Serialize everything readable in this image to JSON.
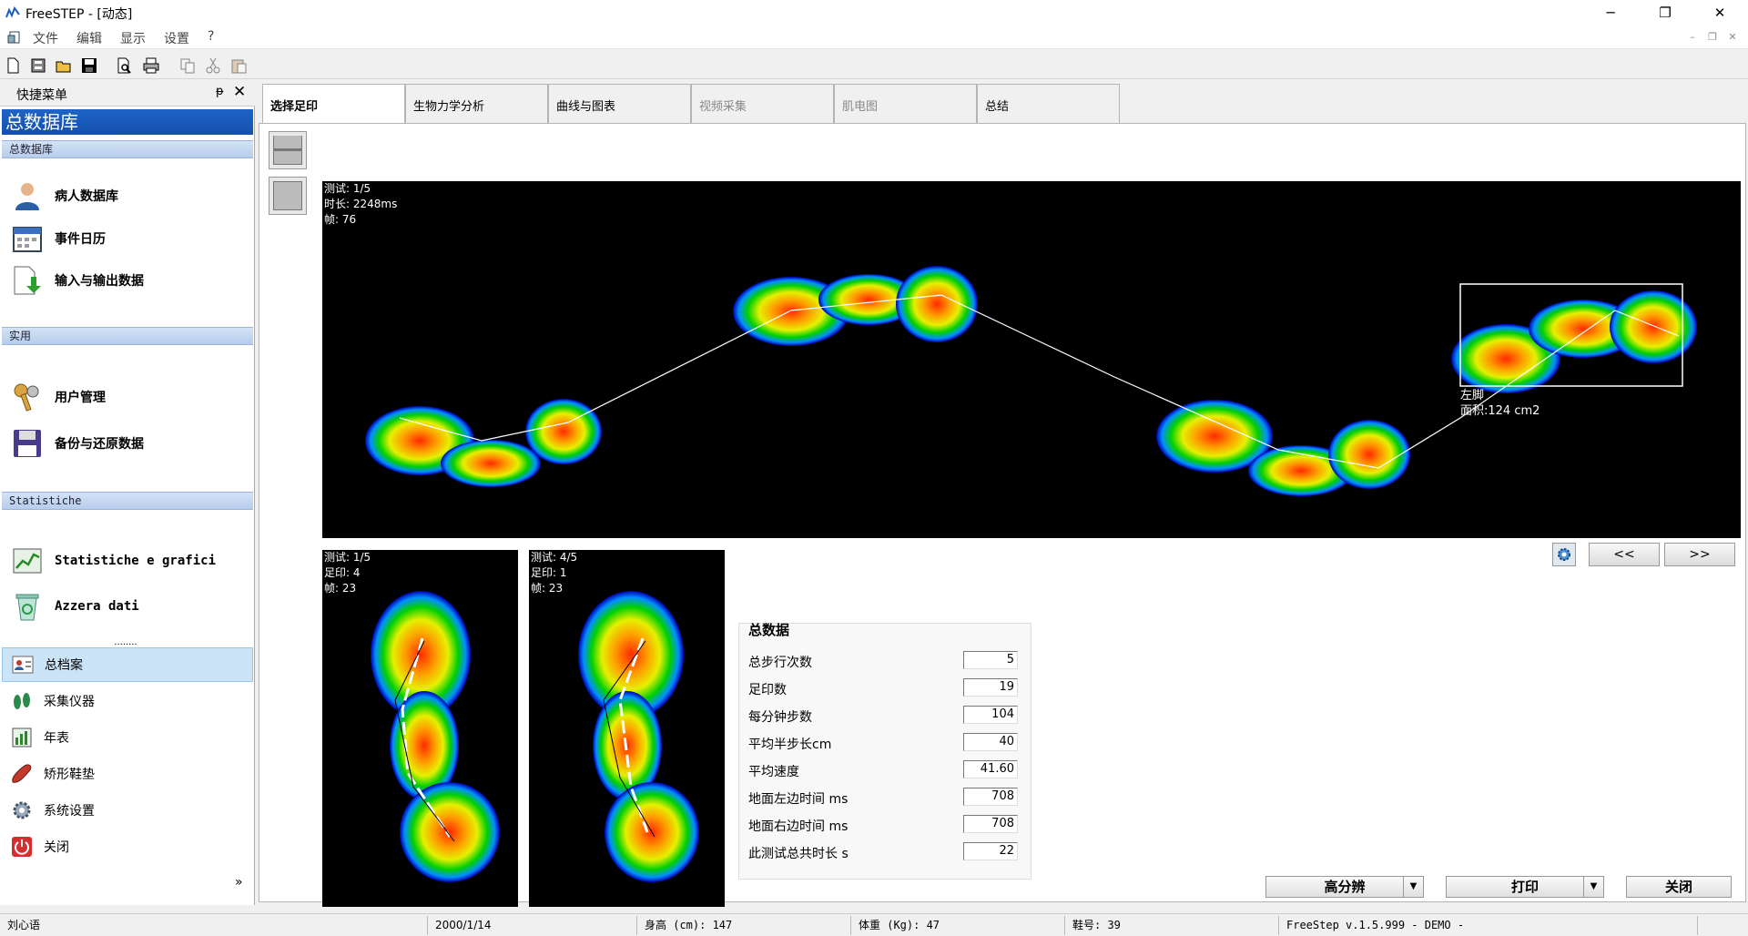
{
  "titlebar": {
    "title": "FreeSTEP - [动态]",
    "minimize": "─",
    "maximize": "❐",
    "close": "✕"
  },
  "menubar": {
    "items": [
      "文件",
      "编辑",
      "显示",
      "设置",
      "?"
    ],
    "mdi": [
      "–",
      "❐",
      "✕"
    ]
  },
  "toolbar": {
    "icons": [
      "new-icon",
      "database-icon",
      "open-icon",
      "save-icon",
      "print-preview-icon",
      "print-icon",
      "copy-icon",
      "cut-icon",
      "paste-icon"
    ]
  },
  "sidebar": {
    "panel_title": "快捷菜单",
    "pin": "ᵽ",
    "close": "✕",
    "header": "总数据库",
    "sections": [
      {
        "title": "总数据库",
        "items": [
          "病人数据库",
          "事件日历",
          "输入与输出数据"
        ]
      },
      {
        "title": "实用",
        "items": [
          "用户管理",
          "备份与还原数据"
        ]
      },
      {
        "title": "Statistiche",
        "items": [
          "Statistiche e grafici",
          "Azzera dati"
        ]
      }
    ],
    "splitter": "........",
    "nav": [
      "总档案",
      "采集仪器",
      "年表",
      "矫形鞋垫",
      "系统设置",
      "关闭"
    ],
    "more": "»"
  },
  "tabs": [
    "选择足印",
    "生物力学分析",
    "曲线与图表",
    "视频采集",
    "肌电图",
    "总结"
  ],
  "mainview": {
    "overlay": "测试: 1/5\n时长: 2248ms\n帧: 76",
    "selection_label": "左脚\n面积:124 cm2"
  },
  "view_left": {
    "overlay": "测试: 1/5\n足印: 4\n帧: 23"
  },
  "view_right": {
    "overlay": "测试: 4/5\n足印: 1\n帧: 23"
  },
  "nav_buttons": {
    "settings_icon": "gear-icon",
    "prev": "<<",
    "next": ">>"
  },
  "stats": {
    "title": "总数据",
    "rows": [
      {
        "label": "总步行次数",
        "value": "5"
      },
      {
        "label": "足印数",
        "value": "19"
      },
      {
        "label": "每分钟步数",
        "value": "104"
      },
      {
        "label": "平均半步长cm",
        "value": "40"
      },
      {
        "label": "平均速度",
        "value": "41.60"
      },
      {
        "label": "地面左边时间 ms",
        "value": "708"
      },
      {
        "label": "地面右边时间 ms",
        "value": "708"
      },
      {
        "label": "此测试总共时长 s",
        "value": "22"
      }
    ]
  },
  "buttons": {
    "hires": "高分辨",
    "print": "打印",
    "close": "关闭",
    "dropdown_arrow": "▼"
  },
  "statusbar": [
    "刘心语",
    "2000/1/14",
    "身高 (cm): 147",
    "体重 (Kg): 47",
    "鞋号: 39",
    "FreeStep v.1.5.999 - DEMO -"
  ]
}
